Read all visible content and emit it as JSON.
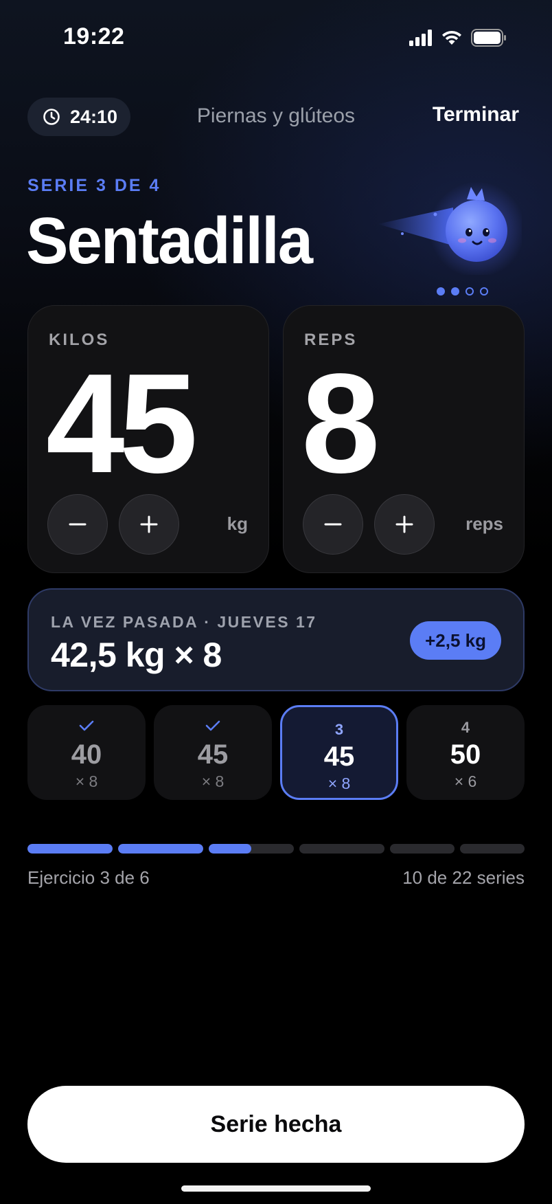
{
  "status_bar": {
    "time": "19:22"
  },
  "header": {
    "timer": "24:10",
    "workout_name": "Piernas y glúteos",
    "finish_label": "Terminar"
  },
  "exercise": {
    "set_label": "SERIE 3 DE 4",
    "name": "Sentadilla",
    "page_dots": {
      "total": 4,
      "filled": 2
    }
  },
  "kilos": {
    "label": "KILOS",
    "value": "45",
    "unit": "kg"
  },
  "reps": {
    "label": "REPS",
    "value": "8",
    "unit": "reps"
  },
  "last_time": {
    "label": "LA VEZ PASADA · JUEVES 17",
    "value": "42,5 kg × 8",
    "delta": "+2,5 kg"
  },
  "sets": [
    {
      "status": "done",
      "marker": "✓",
      "weight": "40",
      "reps": "× 8"
    },
    {
      "status": "done",
      "marker": "✓",
      "weight": "45",
      "reps": "× 8"
    },
    {
      "status": "current",
      "marker": "3",
      "weight": "45",
      "reps": "× 8"
    },
    {
      "status": "pending",
      "marker": "4",
      "weight": "50",
      "reps": "× 6"
    }
  ],
  "progress": {
    "exercise_text": "Ejercicio 3 de 6",
    "series_text": "10 de 22 series",
    "segments_fill": [
      1,
      1,
      0.5,
      0,
      0,
      0
    ]
  },
  "cta_label": "Serie hecha",
  "colors": {
    "accent": "#5b7df5",
    "background": "#000000",
    "card": "#121214"
  }
}
